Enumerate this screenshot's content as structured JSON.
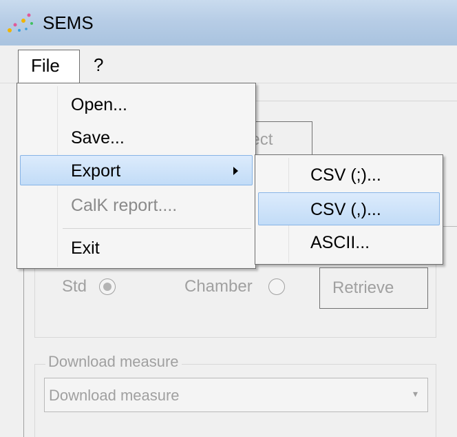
{
  "window": {
    "title": "SEMS"
  },
  "menubar": {
    "file_label": "File",
    "help_label": "?"
  },
  "file_menu": {
    "items": [
      {
        "label": "Open..."
      },
      {
        "label": "Save..."
      },
      {
        "label": "Export"
      },
      {
        "label": "CalK report...."
      },
      {
        "label": "Exit"
      }
    ]
  },
  "export_submenu": {
    "items": [
      {
        "label": "CSV (;)..."
      },
      {
        "label": "CSV (,)..."
      },
      {
        "label": "ASCII..."
      }
    ]
  },
  "form": {
    "connect_label": "nect",
    "std_label": "Std",
    "chamber_label": "Chamber",
    "retrieve_label": "Retrieve",
    "download_group_label": "Download measure",
    "download_select_value": "Download measure"
  },
  "colors": {
    "selection_fill": "#c2dcf7",
    "selection_border": "#86b3e6",
    "titlebar": "#b7cde6",
    "disabled_text": "#a0a0a0"
  }
}
